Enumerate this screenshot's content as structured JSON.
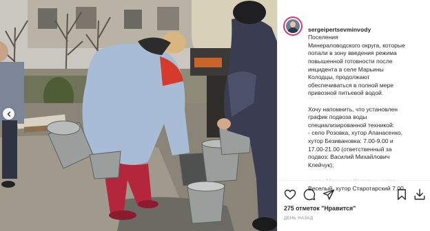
{
  "post": {
    "username": "sergeipertsevminvody",
    "caption_lines_1": "Поселения\nМинераловодского округа, которые\nпопали в зону введения режима\nповышенной готовности после\nинцидента в селе Марьины\nКолодцы, продолжают\nобеспечиваться в полной мере\nпривозной питьевой водой.",
    "caption_lines_2": "Хочу напомнить, что установлен\nграфик подвоза воды\nспециализированной техникой:\n- село Розовка, хутор Апанасенко,\nхутор Безивановка: 7.00-9.00 и\n17.00-21.00 (ответственный за\nподвоз: Василий Михайлович\nКлейчук);",
    "caption_lines_3": "- село Марьины Колодцы, хутор\nВеселый, хутор Старотарский 7.00",
    "likes": "275 отметок \"Нравится\"",
    "date": "ДЕНЬ НАЗАД"
  },
  "icons": {
    "avatar": "avatar-photo",
    "prev": "chevron-left-icon",
    "like": "heart-icon",
    "comment": "comment-icon",
    "share": "paper-plane-icon",
    "save": "bookmark-icon",
    "download": "download-icon"
  },
  "colors": {
    "story_ring": "#d43a6a",
    "text": "#262626",
    "muted": "#8e8e8e"
  }
}
